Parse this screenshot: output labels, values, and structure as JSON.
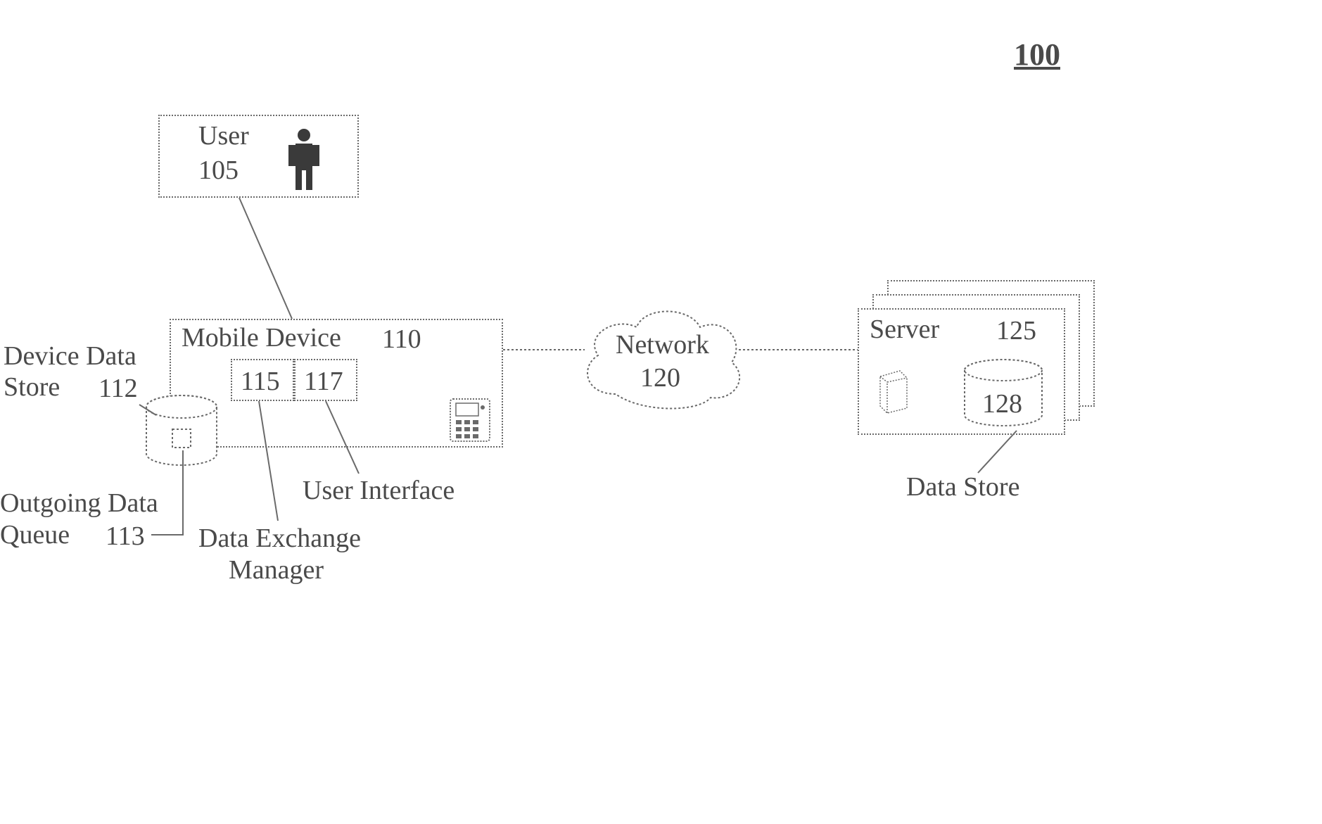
{
  "figure_ref": "100",
  "user": {
    "label": "User",
    "ref": "105"
  },
  "mobile_device": {
    "label": "Mobile Device",
    "ref": "110",
    "sub115": "115",
    "sub117": "117"
  },
  "device_data_store": {
    "label": "Device Data",
    "label2": "Store",
    "ref": "112"
  },
  "outgoing_queue": {
    "label": "Outgoing Data",
    "label2": "Queue",
    "ref": "113"
  },
  "data_exchange_mgr": {
    "label1": "Data Exchange",
    "label2": "Manager"
  },
  "user_interface": {
    "label": "User Interface"
  },
  "network": {
    "label": "Network",
    "ref": "120"
  },
  "server": {
    "label": "Server",
    "ref": "125",
    "datastore_ref": "128"
  },
  "data_store": {
    "label": "Data Store"
  }
}
